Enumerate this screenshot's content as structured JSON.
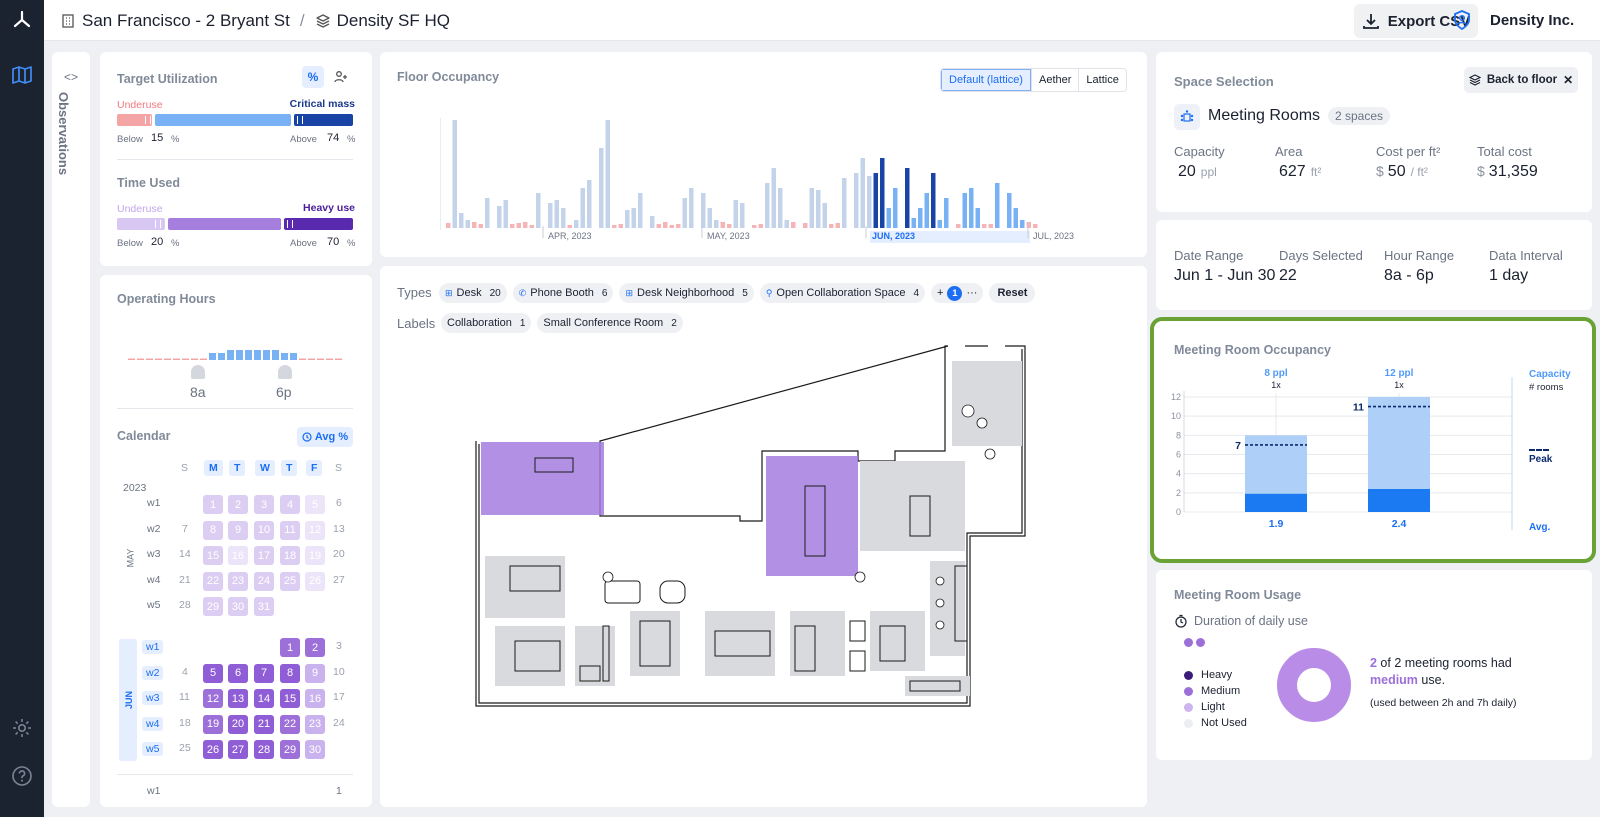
{
  "topbar": {
    "location": "San Francisco - 2 Bryant St",
    "separator": "/",
    "floor": "Density SF HQ",
    "export_label": "Export CSV",
    "org": "Density Inc."
  },
  "observations": {
    "label": "Observations"
  },
  "target_utilization": {
    "title": "Target Utilization",
    "toggle_percent": "%",
    "underuse": "Underuse",
    "critical": "Critical mass",
    "below_label": "Below",
    "below_value": "15",
    "above_label": "Above",
    "above_value": "74",
    "unit": "%"
  },
  "time_used": {
    "title": "Time Used",
    "underuse": "Underuse",
    "heavy": "Heavy use",
    "below_label": "Below",
    "below_value": "20",
    "above_label": "Above",
    "above_value": "70",
    "unit": "%"
  },
  "operating_hours": {
    "title": "Operating Hours",
    "start": "8a",
    "end": "6p"
  },
  "calendar": {
    "title": "Calendar",
    "avg_button": "Avg %",
    "year": "2023",
    "weekdays": [
      "S",
      "M",
      "T",
      "W",
      "T",
      "F",
      "S"
    ],
    "may_label": "MAY",
    "jun_label": "JUN",
    "may_weeks": [
      {
        "w": "w1",
        "days": [
          "",
          "1",
          "2",
          "3",
          "4",
          "5",
          "6"
        ]
      },
      {
        "w": "w2",
        "days": [
          "7",
          "8",
          "9",
          "10",
          "11",
          "12",
          "13"
        ]
      },
      {
        "w": "w3",
        "days": [
          "14",
          "15",
          "16",
          "17",
          "18",
          "19",
          "20"
        ]
      },
      {
        "w": "w4",
        "days": [
          "21",
          "22",
          "23",
          "24",
          "25",
          "26",
          "27"
        ]
      },
      {
        "w": "w5",
        "days": [
          "28",
          "29",
          "30",
          "31",
          "",
          "",
          ""
        ]
      }
    ],
    "jun_weeks": [
      {
        "w": "w1",
        "days": [
          "",
          "",
          "",
          "",
          "1",
          "2",
          "3"
        ]
      },
      {
        "w": "w2",
        "days": [
          "4",
          "5",
          "6",
          "7",
          "8",
          "9",
          "10"
        ]
      },
      {
        "w": "w3",
        "days": [
          "11",
          "12",
          "13",
          "14",
          "15",
          "16",
          "17"
        ]
      },
      {
        "w": "w4",
        "days": [
          "18",
          "19",
          "20",
          "21",
          "22",
          "23",
          "24"
        ]
      },
      {
        "w": "w5",
        "days": [
          "25",
          "26",
          "27",
          "28",
          "29",
          "30",
          ""
        ]
      }
    ],
    "jul_first": {
      "w": "w1",
      "last": "1"
    }
  },
  "floor_occupancy": {
    "title": "Floor Occupancy",
    "tabs": [
      "Default (lattice)",
      "Aether",
      "Lattice"
    ],
    "months": [
      "APR, 2023",
      "MAY, 2023",
      "JUN, 2023",
      "JUL, 2023"
    ]
  },
  "filters": {
    "types_label": "Types",
    "types": [
      {
        "label": "Desk",
        "count": "20"
      },
      {
        "label": "Phone Booth",
        "count": "6"
      },
      {
        "label": "Desk Neighborhood",
        "count": "5"
      },
      {
        "label": "Open Collaboration Space",
        "count": "4"
      }
    ],
    "more_plus": "+",
    "more_count": "1",
    "more_dots": "···",
    "reset": "Reset",
    "labels_label": "Labels",
    "labels": [
      {
        "label": "Collaboration",
        "count": "1"
      },
      {
        "label": "Small Conference Room",
        "count": "2"
      }
    ]
  },
  "space_selection": {
    "title": "Space Selection",
    "back": "Back to floor",
    "name": "Meeting Rooms",
    "count": "2 spaces",
    "stats": [
      {
        "label": "Capacity",
        "prefix": "",
        "value": "20",
        "unit": "ppl"
      },
      {
        "label": "Area",
        "prefix": "",
        "value": "627",
        "unit": "ft²"
      },
      {
        "label": "Cost per ft²",
        "prefix": "$",
        "value": "50",
        "unit": "/ ft²"
      },
      {
        "label": "Total cost",
        "prefix": "$",
        "value": "31,359",
        "unit": ""
      }
    ]
  },
  "date_info": [
    {
      "label": "Date Range",
      "value": "Jun 1 - Jun 30"
    },
    {
      "label": "Days Selected",
      "value": "22"
    },
    {
      "label": "Hour Range",
      "value": "8a - 6p"
    },
    {
      "label": "Data Interval",
      "value": "1 day"
    }
  ],
  "meeting_occupancy": {
    "title": "Meeting Room Occupancy",
    "capacity_label": "Capacity",
    "rooms_label": "# rooms",
    "peak_label": "Peak",
    "avg_label": "Avg.",
    "y_ticks": [
      "12",
      "10",
      "8",
      "6",
      "4",
      "2",
      "0"
    ]
  },
  "chart_data": {
    "type": "bar",
    "categories": [
      "8 ppl",
      "12 ppl"
    ],
    "room_counts": [
      "1x",
      "1x"
    ],
    "capacity": [
      8,
      12
    ],
    "peak": [
      7,
      11
    ],
    "avg": [
      1.9,
      2.4
    ],
    "avg_labels": [
      "1.9",
      "2.4"
    ],
    "peak_labels": [
      "7",
      "11"
    ],
    "ylim": [
      0,
      12
    ]
  },
  "usage": {
    "title": "Meeting Room Usage",
    "subtitle": "Duration of daily use",
    "legend": [
      "Heavy",
      "Medium",
      "Light",
      "Not Used"
    ],
    "legend_colors": [
      "#3b1c7a",
      "#9c6fd9",
      "#cdb5ee",
      "#eceef2"
    ],
    "count": "2",
    "text1": " of 2 meeting rooms had",
    "level": "medium",
    "text2": " use.",
    "note": "(used between 2h and 7h daily)"
  },
  "colors": {
    "accent": "#1c6ef2",
    "purple": "#9c6fd9",
    "highlight": "#6aa235",
    "rail": "#1b2230"
  }
}
